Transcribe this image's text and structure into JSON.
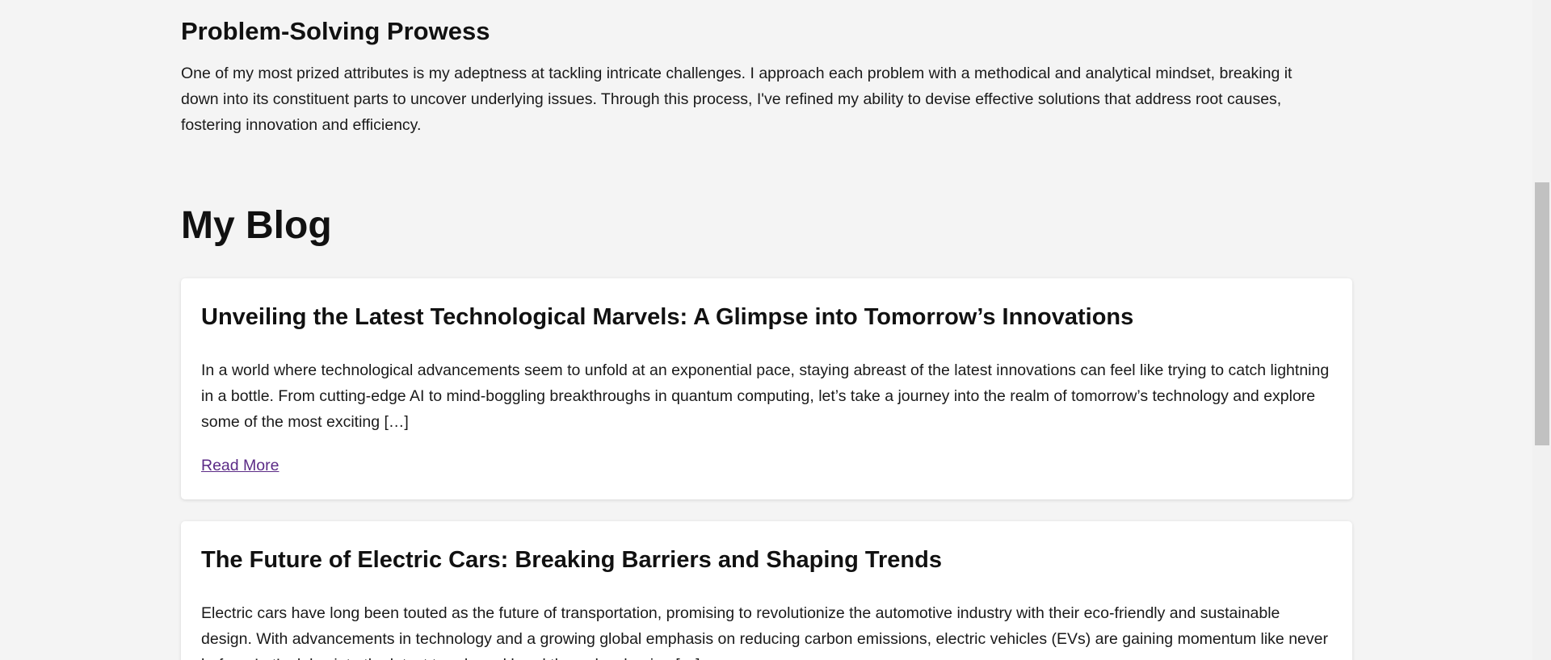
{
  "skills_section": {
    "heading": "Problem-Solving Prowess",
    "text": "One of my most prized attributes is my adeptness at tackling intricate challenges. I approach each problem with a methodical and analytical mindset, breaking it down into its constituent parts to uncover underlying issues. Through this process, I've refined my ability to devise effective solutions that address root causes, fostering innovation and efficiency."
  },
  "blog": {
    "title": "My Blog",
    "posts": [
      {
        "title": "Unveiling the Latest Technological Marvels: A Glimpse into Tomorrow’s Innovations",
        "excerpt": "In a world where technological advancements seem to unfold at an exponential pace, staying abreast of the latest innovations can feel like trying to catch lightning in a bottle. From cutting-edge AI to mind-boggling breakthroughs in quantum computing, let’s take a journey into the realm of tomorrow’s technology and explore some of the most exciting […]",
        "read_more_label": "Read More"
      },
      {
        "title": "The Future of Electric Cars: Breaking Barriers and Shaping Trends",
        "excerpt": "Electric cars have long been touted as the future of transportation, promising to revolutionize the automotive industry with their eco-friendly and sustainable design. With advancements in technology and a growing global emphasis on reducing carbon emissions, electric vehicles (EVs) are gaining momentum like never before. Let’s delve into the latest trends and breakthroughs shaping […]"
      }
    ]
  },
  "colors": {
    "page_background": "#f4f4f4",
    "card_background": "#ffffff",
    "link_visited": "#5b2a86"
  }
}
